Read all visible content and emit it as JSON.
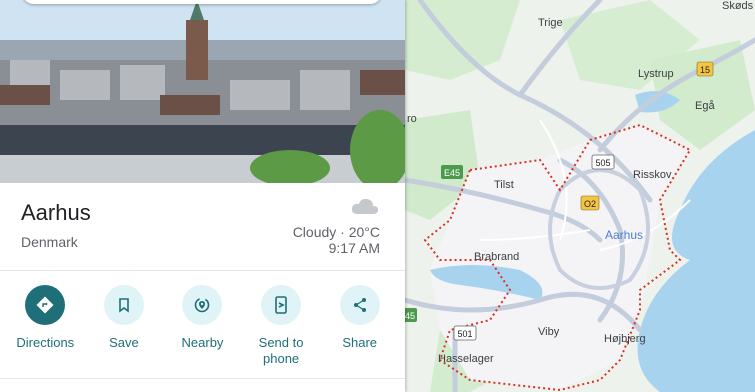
{
  "place": {
    "name": "Aarhus",
    "country": "Denmark"
  },
  "weather": {
    "summary": "Cloudy · 20°C",
    "time": "9:17 AM",
    "icon": "cloud-icon"
  },
  "actions": [
    {
      "label": "Directions",
      "icon": "directions-icon"
    },
    {
      "label": "Save",
      "icon": "bookmark-icon"
    },
    {
      "label": "Nearby",
      "icon": "nearby-icon"
    },
    {
      "label": "Send to phone",
      "icon": "send-to-phone-icon"
    },
    {
      "label": "Share",
      "icon": "share-icon"
    }
  ],
  "map": {
    "city_label": "Aarhus",
    "places": [
      "Skøds",
      "Trige",
      "Lystrup",
      "Egå",
      "Risskov",
      "Tilst",
      "Brabrand",
      "Viby",
      "Højbjerg",
      "Hasselager",
      "ro"
    ],
    "road_shields": [
      "15",
      "505",
      "O2",
      "E45",
      "45",
      "501"
    ]
  },
  "colors": {
    "accent": "#1f6f79",
    "boundary": "#d93025",
    "water": "#a8d3ef",
    "park": "#c9e8c4"
  }
}
